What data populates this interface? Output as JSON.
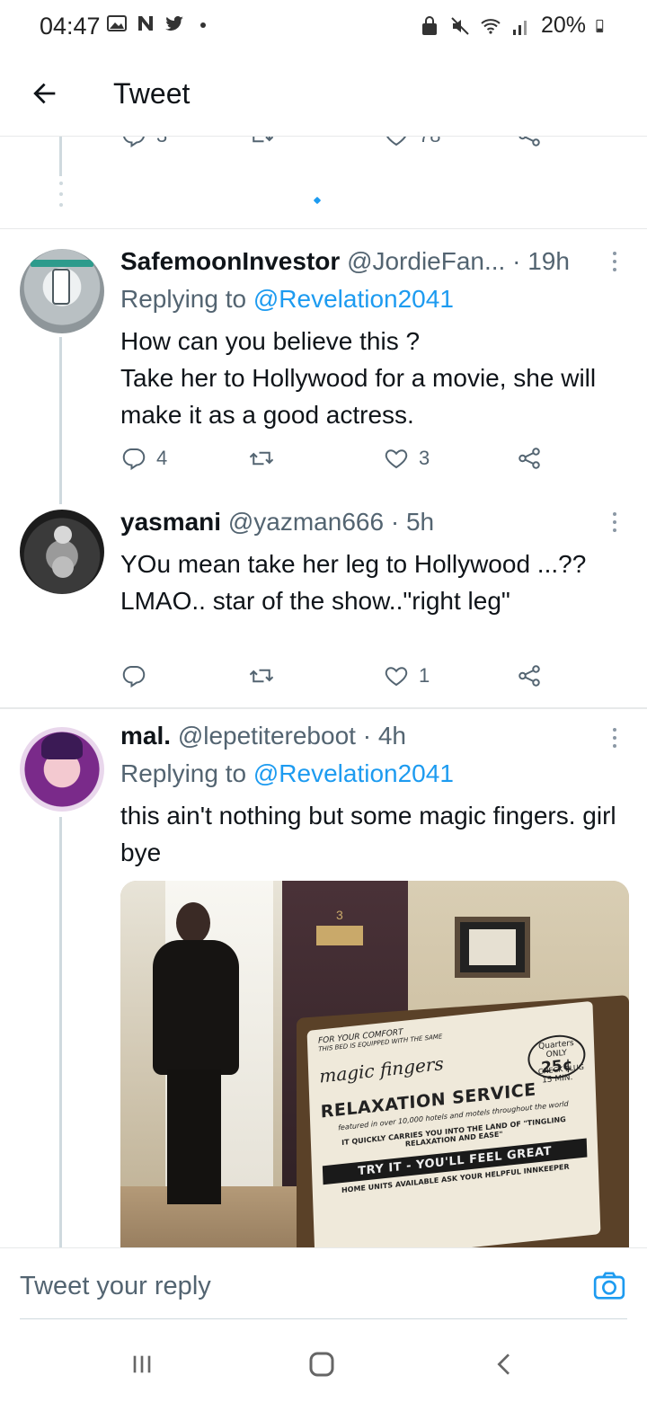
{
  "status_bar": {
    "time": "04:47",
    "battery": "20%",
    "left_icons": [
      "image-icon",
      "n-app-icon",
      "twitter-bird-icon",
      "dot-icon"
    ],
    "right_icons": [
      "lock-icon",
      "mute-icon",
      "wifi-icon",
      "signal-icon",
      "battery-icon"
    ]
  },
  "header": {
    "title": "Tweet",
    "back_icon": "arrow-left-icon"
  },
  "partial_tweet": {
    "reply_count": "3",
    "like_count": "78"
  },
  "tweets": [
    {
      "name": "SafemoonInvestor",
      "handle": "@JordieFan...",
      "dot": "·",
      "time": "19h",
      "replying_prefix": "Replying to",
      "replying_to": "@Revelation2041",
      "text": "How can you believe this ?\nTake her to Hollywood for a movie, she will make it as a good actress.",
      "replies": "4",
      "retweets": "",
      "likes": "3"
    },
    {
      "name": "yasmani",
      "handle": "@yazman666",
      "dot": "·",
      "time": "5h",
      "text": "YOu mean take her leg to Hollywood ...?? LMAO.. star of the show..\"right leg\"",
      "replies": "",
      "retweets": "",
      "likes": "1"
    },
    {
      "name": "mal.",
      "handle": "@lepetitereboot",
      "dot": "·",
      "time": "4h",
      "replying_prefix": "Replying to",
      "replying_to": "@Revelation2041",
      "text": "this ain't nothing but some magic fingers. girl bye",
      "media": {
        "door_number": "3",
        "plate_top": "FOR YOUR COMFORT",
        "plate_sub": "THIS BED IS EQUIPPED WITH THE SAME",
        "brand": "magic fingers",
        "coin_top": "Quarters ONLY",
        "coin_value": "25¢",
        "coin_bottom": "15 MIN.",
        "check_plug": "CHECK PLUG",
        "service": "RELAXATION SERVICE",
        "featured": "featured in over 10,000 hotels and motels throughout the world",
        "tagline": "IT QUICKLY CARRIES YOU INTO THE LAND OF \"TINGLING RELAXATION AND EASE\"",
        "banner": "TRY IT - YOU'LL FEEL GREAT",
        "footer": "HOME UNITS AVAILABLE ASK YOUR HELPFUL INNKEEPER"
      }
    }
  ],
  "reply_bar": {
    "placeholder": "Tweet your reply",
    "camera_icon": "camera-icon"
  },
  "nav_bar": {
    "icons": [
      "recent-apps-icon",
      "home-icon",
      "back-icon"
    ]
  },
  "colors": {
    "accent": "#1d9bf0",
    "secondary_text": "#536471",
    "primary_text": "#0f1419",
    "divider": "#e7e9ea"
  }
}
